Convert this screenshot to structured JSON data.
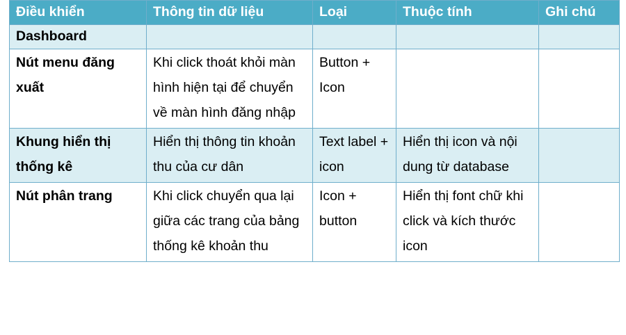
{
  "table": {
    "headers": [
      "Điều khiển",
      "Thông tin dữ liệu",
      "Loại",
      "Thuộc tính",
      "Ghi chú"
    ],
    "rows": [
      {
        "control": "Dashboard",
        "info": "",
        "type": "",
        "attr": "",
        "note": ""
      },
      {
        "control": "Nút menu đăng xuất",
        "info": "Khi click thoát khỏi màn hình hiện tại để chuyển về màn hình đăng nhập",
        "type": "Button + Icon",
        "attr": "",
        "note": ""
      },
      {
        "control": "Khung hiển thị thống kê",
        "info": "Hiển thị thông tin khoản thu của cư dân",
        "type": "Text label + icon",
        "attr": "Hiển thị icon và nội dung từ database",
        "note": ""
      },
      {
        "control": "Nút phân trang",
        "info": "Khi click chuyển qua lại giữa các trang của bảng thống kê khoản thu",
        "type": "Icon + button",
        "attr": "Hiển thị font chữ khi click và kích thước icon",
        "note": ""
      }
    ]
  }
}
